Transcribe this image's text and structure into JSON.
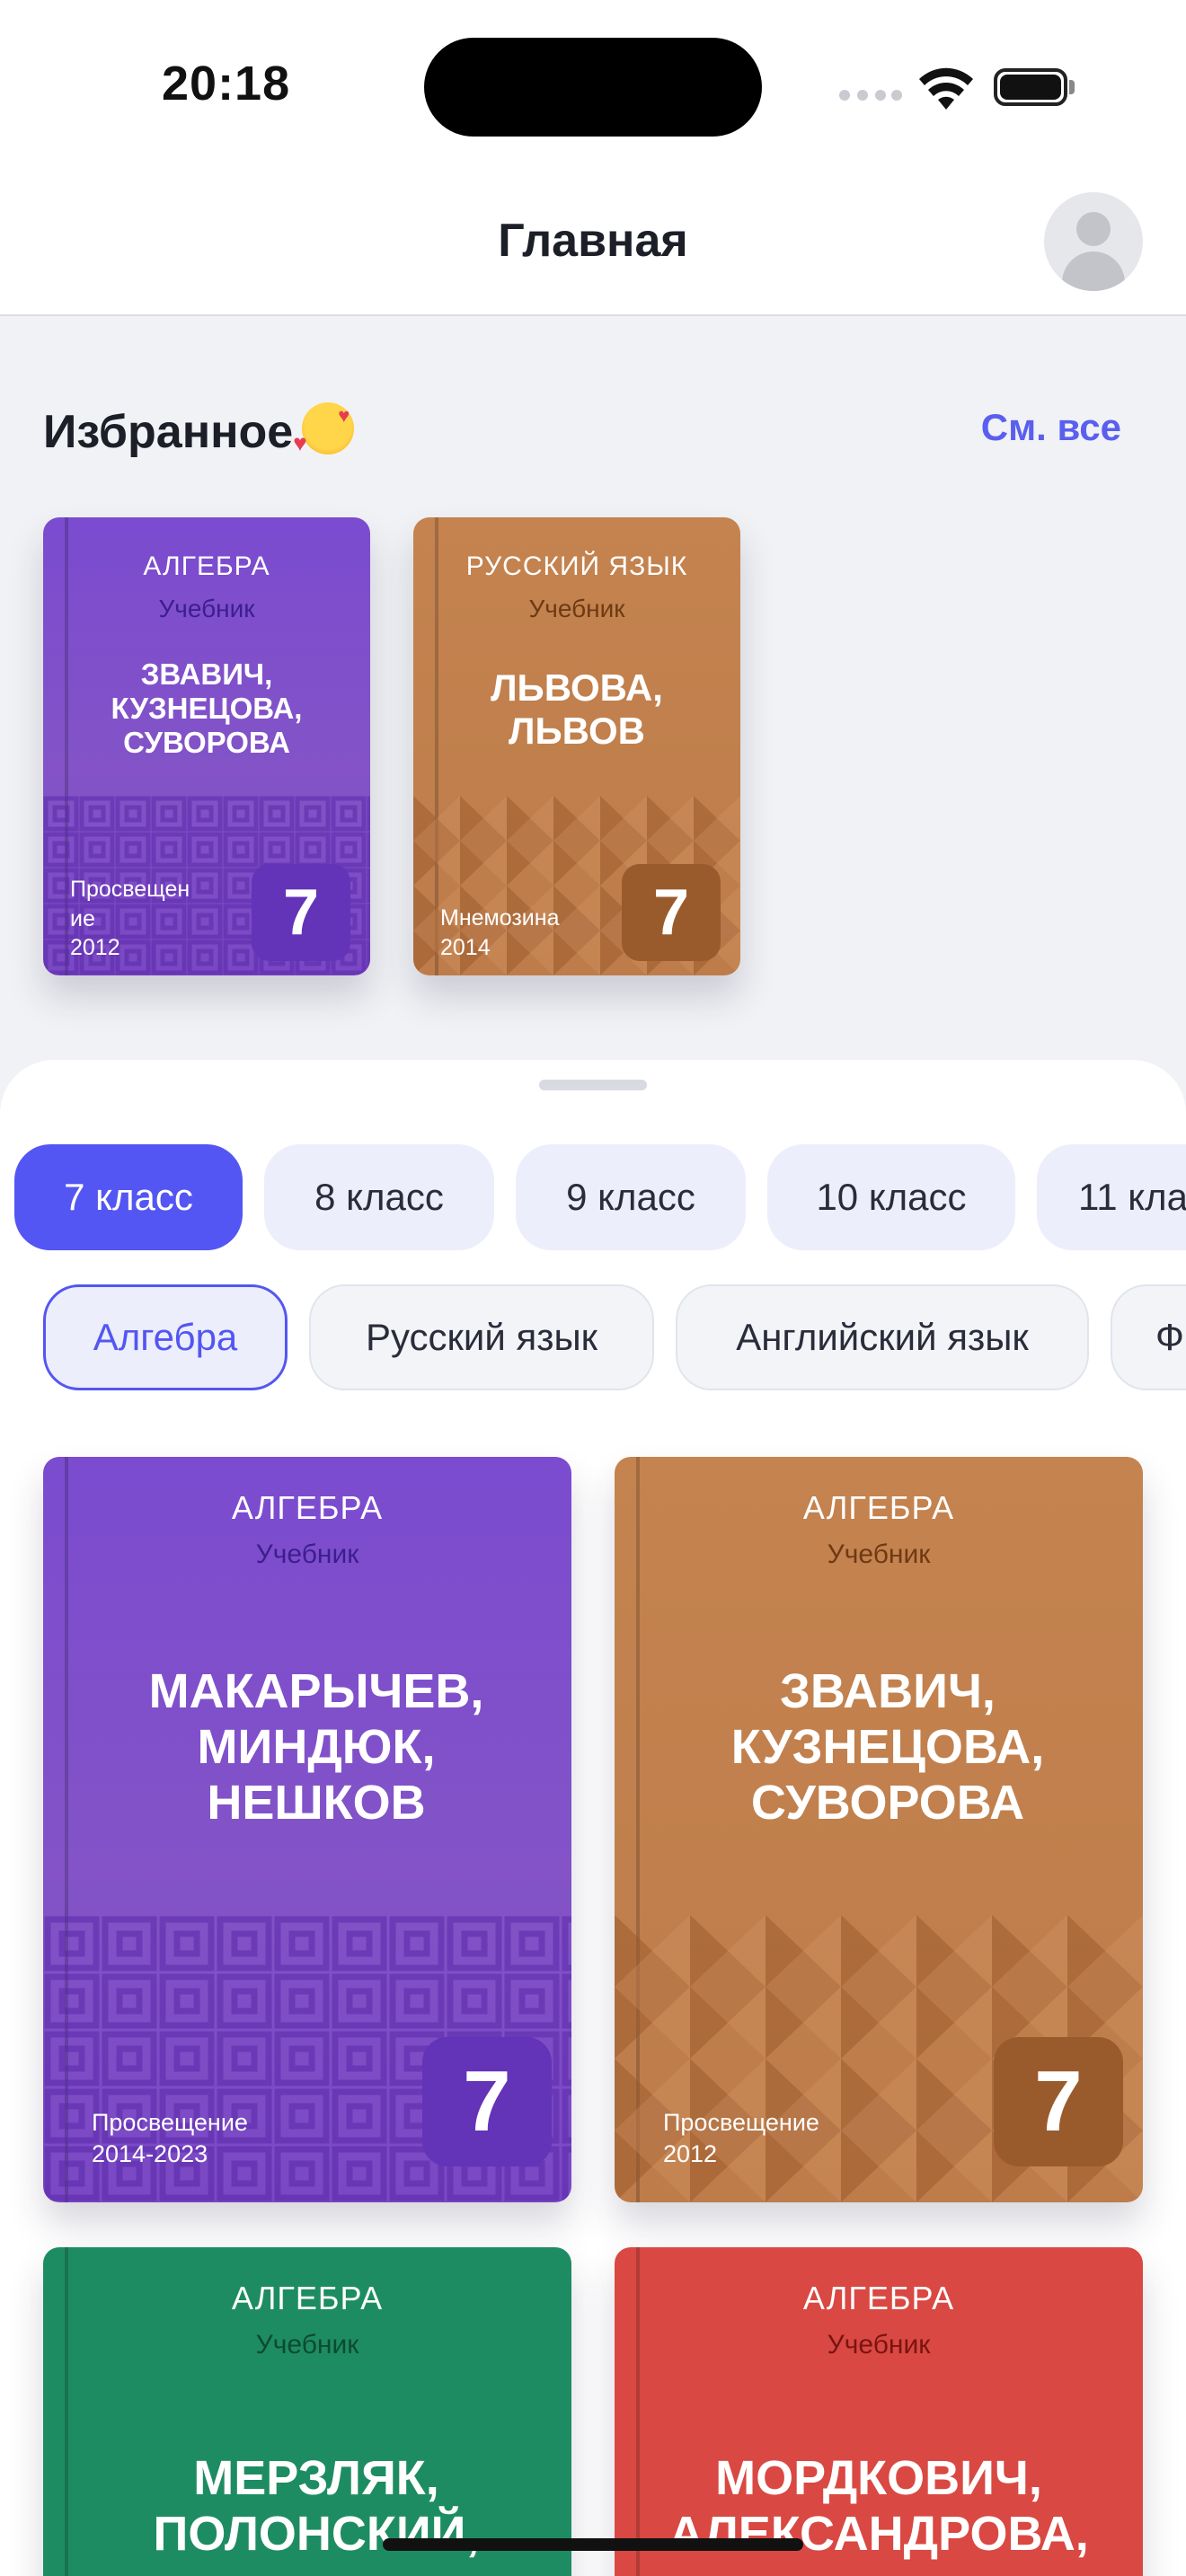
{
  "status_bar": {
    "time": "20:18"
  },
  "header": {
    "title": "Главная"
  },
  "favorites": {
    "title": "Избранное",
    "emoji_icon": "smiling-face-with-hearts-icon",
    "see_all": "См. все",
    "books": [
      {
        "subject": "АЛГЕБРА",
        "kind": "Учебник",
        "authors": [
          "ЗВАВИЧ,",
          "КУЗНЕЦОВА,",
          "СУВОРОВА"
        ],
        "publisher_lines": [
          "Просвещен",
          "ие"
        ],
        "year": "2012",
        "grade": "7",
        "color": "#7b4bd0"
      },
      {
        "subject": "РУССКИЙ ЯЗЫК",
        "kind": "Учебник",
        "authors": [
          "ЛЬВОВА,",
          "ЛЬВОВ"
        ],
        "publisher_lines": [
          "Мнемозина"
        ],
        "year": "2014",
        "grade": "7",
        "color": "#c4834f"
      }
    ]
  },
  "grade_filters": [
    "7 класс",
    "8 класс",
    "9 класс",
    "10 класс",
    "11 кла"
  ],
  "subject_filters": [
    "Алгебра",
    "Русский язык",
    "Английский язык",
    "Ф"
  ],
  "books": [
    {
      "subject": "АЛГЕБРА",
      "kind": "Учебник",
      "authors": [
        "МАКАРЫЧЕВ,",
        "МИНДЮК,",
        "НЕШКОВ"
      ],
      "publisher": "Просвещение",
      "year": "2014-2023",
      "grade": "7",
      "color": "#7b4bd0"
    },
    {
      "subject": "АЛГЕБРА",
      "kind": "Учебник",
      "authors": [
        "ЗВАВИЧ,",
        "КУЗНЕЦОВА,",
        "СУВОРОВА"
      ],
      "publisher": "Просвещение",
      "year": "2012",
      "grade": "7",
      "color": "#c4834f"
    },
    {
      "subject": "АЛГЕБРА",
      "kind": "Учебник",
      "authors": [
        "МЕРЗЛЯК,",
        "ПОЛОНСКИЙ,"
      ],
      "publisher": "",
      "year": "",
      "grade": "",
      "color": "#1e8c62"
    },
    {
      "subject": "АЛГЕБРА",
      "kind": "Учебник",
      "authors": [
        "МОРДКОВИЧ,",
        "АЛЕКСАНДРОВА,"
      ],
      "publisher": "",
      "year": "",
      "grade": "",
      "color": "#d94842"
    }
  ]
}
